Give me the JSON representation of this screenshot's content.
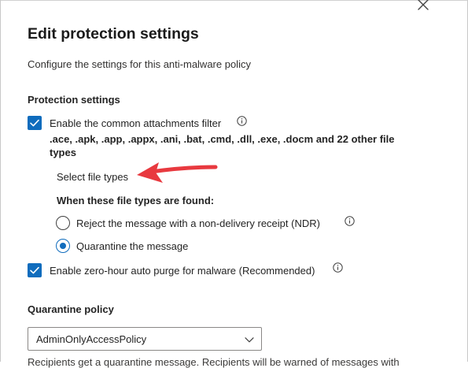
{
  "panel": {
    "title": "Edit protection settings",
    "subtitle": "Configure the settings for this anti-malware policy",
    "close_icon": "close-icon"
  },
  "protection": {
    "heading": "Protection settings",
    "common_filter": {
      "label": "Enable the common attachments filter",
      "checked": true,
      "file_types_line1": ".ace, .apk, .app, .appx, .ani, .bat, .cmd, .dll, .exe, .docm and 22 other file",
      "file_types_line2": "types",
      "select_file_types": "Select file types"
    },
    "when_found": {
      "heading": "When these file types are found:",
      "options": [
        {
          "label": "Reject the message with a non-delivery receipt (NDR)",
          "selected": false
        },
        {
          "label": "Quarantine the message",
          "selected": true
        }
      ]
    },
    "zap": {
      "label": "Enable zero-hour auto purge for malware (Recommended)",
      "checked": true
    }
  },
  "quarantine": {
    "heading": "Quarantine policy",
    "selected_value": "AdminOnlyAccessPolicy",
    "cutoff_text": "Recipients get a quarantine message. Recipients will be warned of messages with"
  },
  "colors": {
    "accent": "#0f6cbd",
    "annotation_arrow": "#e8393f"
  }
}
